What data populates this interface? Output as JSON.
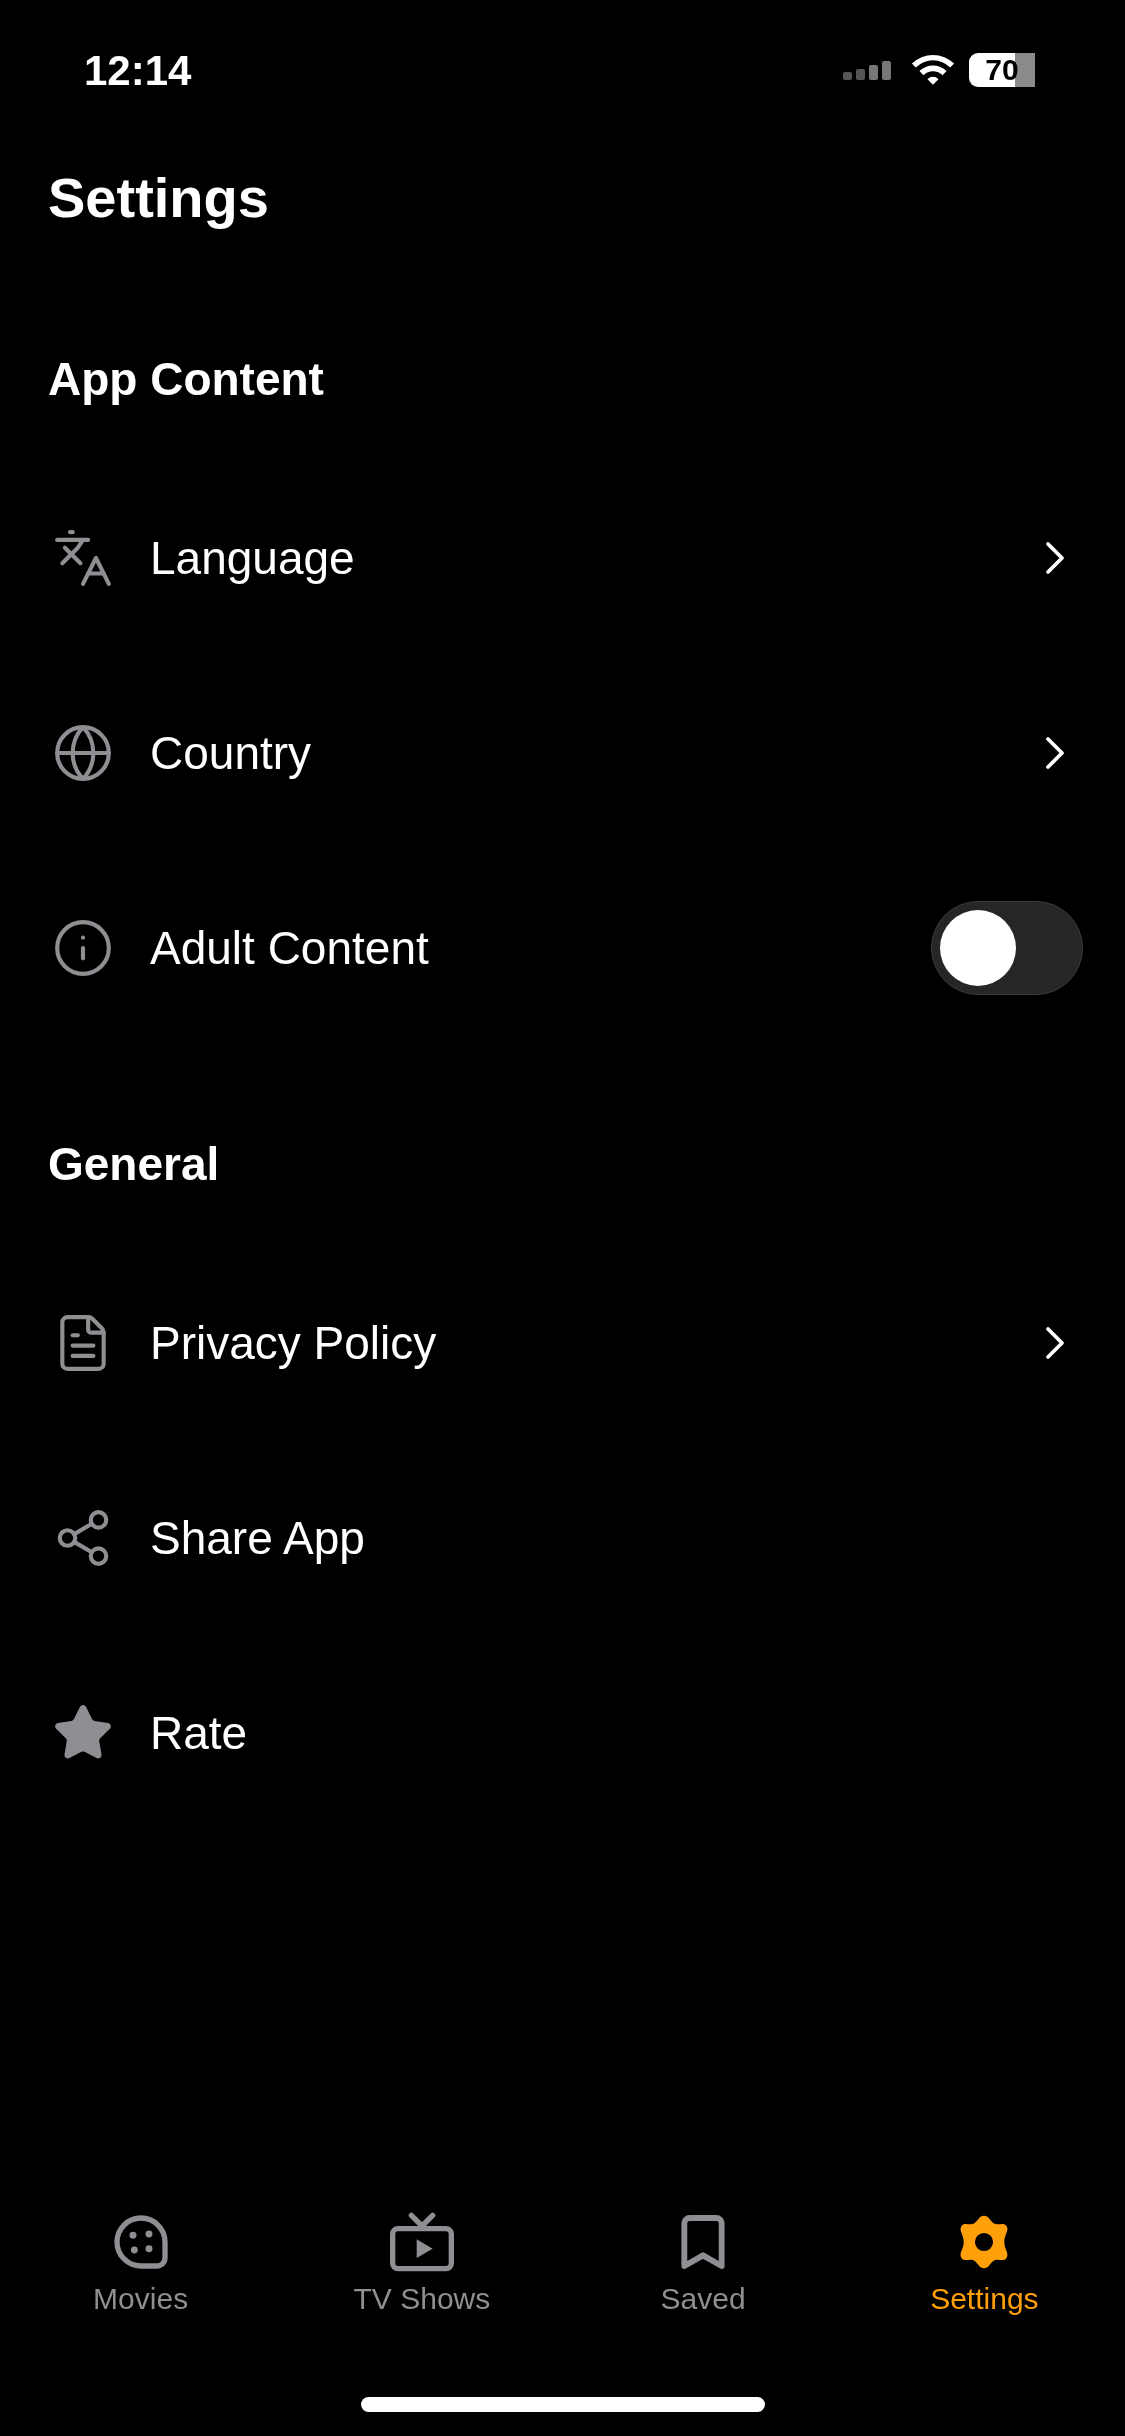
{
  "status_bar": {
    "time": "12:14",
    "battery": "70"
  },
  "title": "Settings",
  "sections": [
    {
      "title": "App Content",
      "rows": [
        {
          "kind": "link",
          "label": "Language"
        },
        {
          "kind": "link",
          "label": "Country"
        },
        {
          "kind": "toggle",
          "label": "Adult Content",
          "on": false
        }
      ]
    },
    {
      "title": "General",
      "rows": [
        {
          "kind": "link",
          "label": "Privacy Policy"
        },
        {
          "kind": "action",
          "label": "Share App"
        },
        {
          "kind": "action",
          "label": "Rate"
        }
      ]
    }
  ],
  "tabs": [
    {
      "label": "Movies",
      "selected": false
    },
    {
      "label": "TV Shows",
      "selected": false
    },
    {
      "label": "Saved",
      "selected": false
    },
    {
      "label": "Settings",
      "selected": true
    }
  ]
}
